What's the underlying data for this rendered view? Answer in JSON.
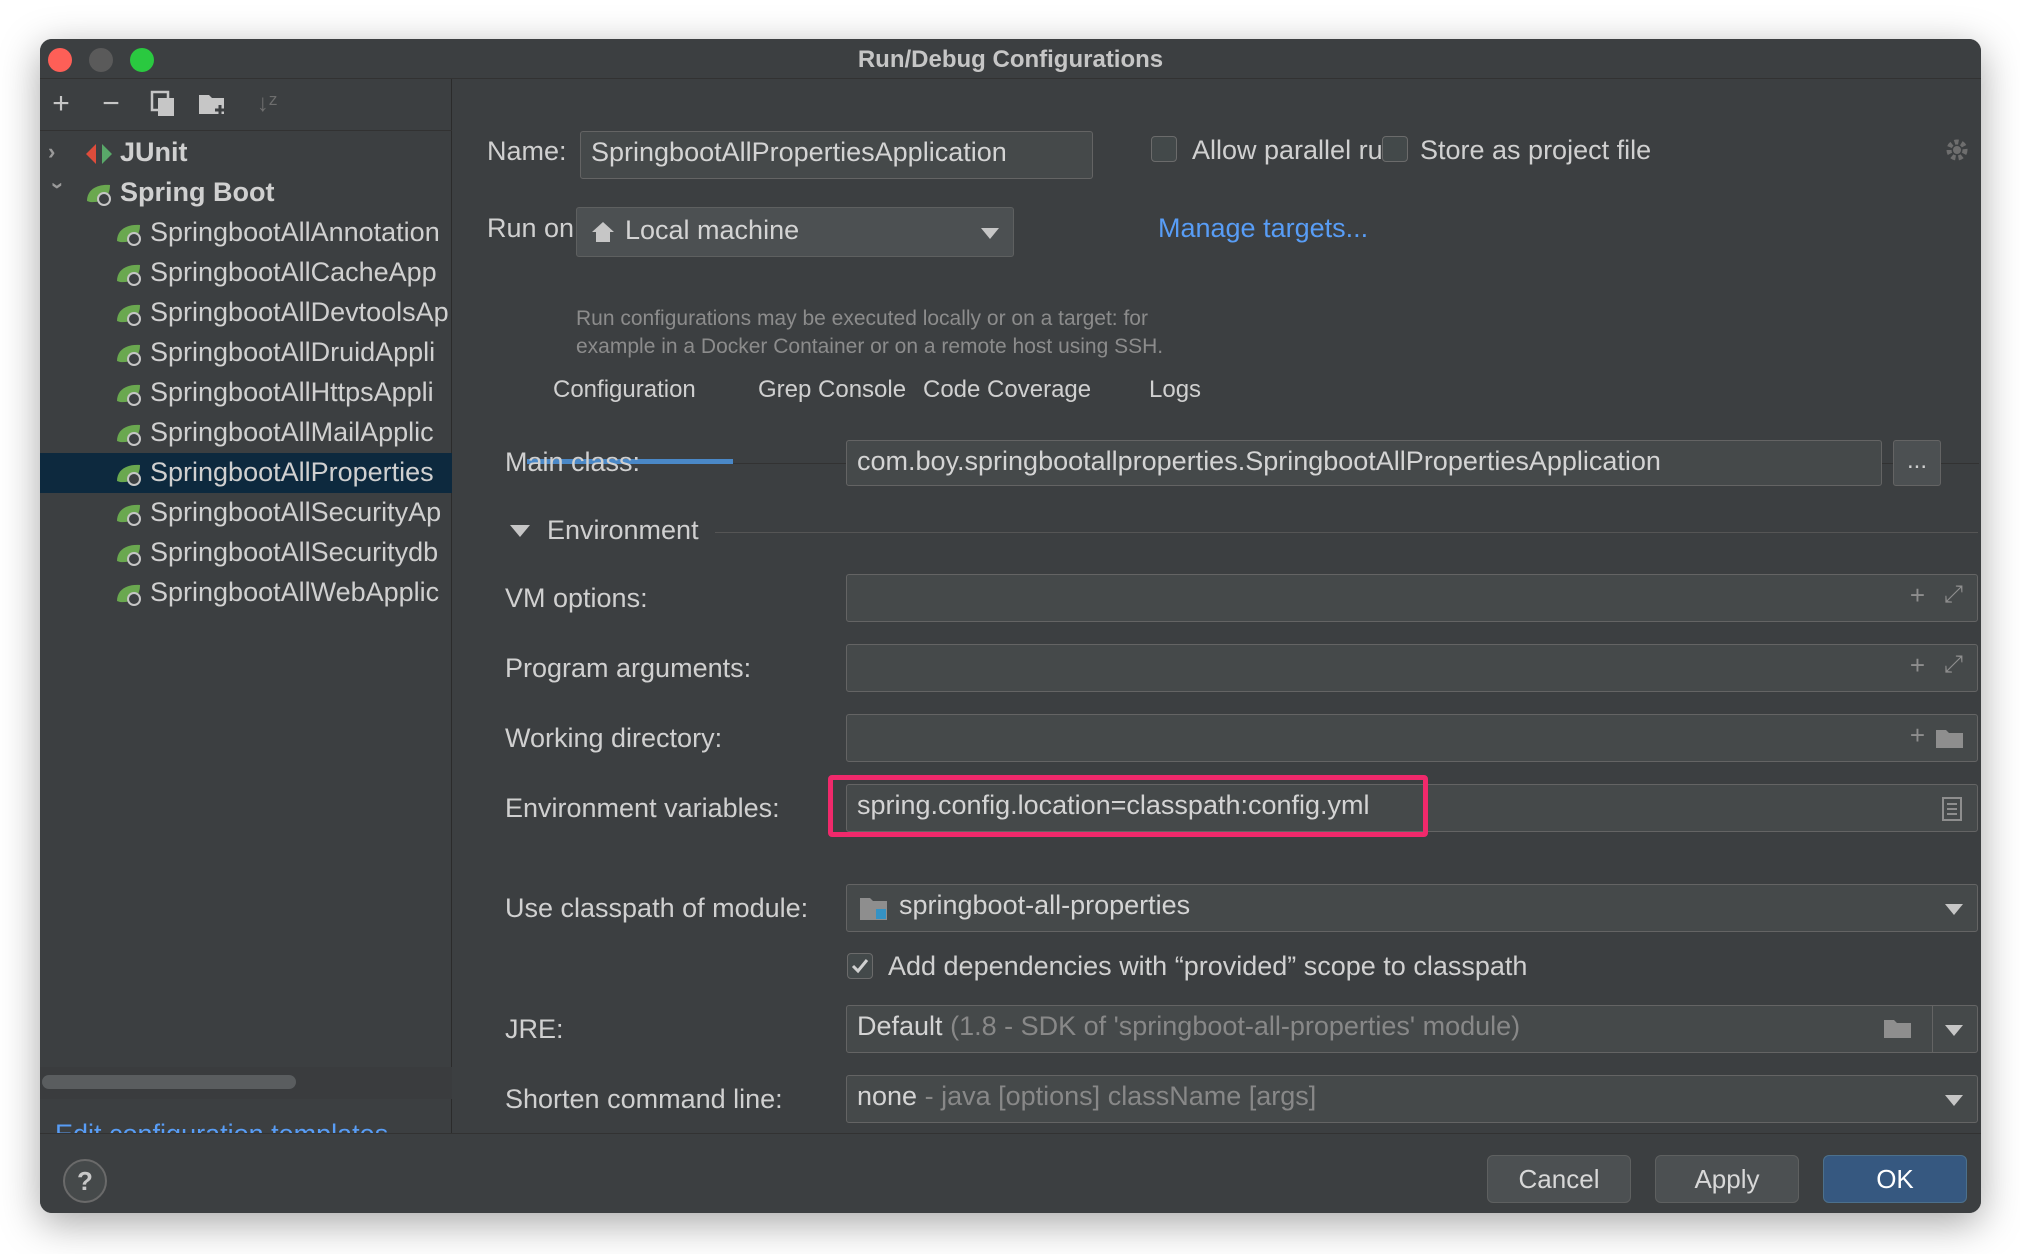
{
  "window": {
    "title": "Run/Debug Configurations"
  },
  "toolbar": {
    "add_icon": "plus-icon",
    "remove_icon": "minus-icon",
    "copy_icon": "copy-icon",
    "folder_icon": "new-folder-icon",
    "sort_icon": "sort-icon"
  },
  "tree": {
    "groups": [
      {
        "label": "JUnit",
        "expanded": false
      },
      {
        "label": "Spring Boot",
        "expanded": true
      }
    ],
    "items": [
      "SpringbootAllAnnotation",
      "SpringbootAllCacheApp",
      "SpringbootAllDevtoolsAp",
      "SpringbootAllDruidAppli",
      "SpringbootAllHttpsAppli",
      "SpringbootAllMailApplic",
      "SpringbootAllProperties",
      "SpringbootAllSecurityAp",
      "SpringbootAllSecuritydb",
      "SpringbootAllWebApplic"
    ],
    "selected_index": 6
  },
  "sidebar": {
    "edit_templates": "Edit configuration templates..."
  },
  "form": {
    "name_label": "Name:",
    "name_value": "SpringbootAllPropertiesApplication",
    "allow_parallel": "Allow parallel run",
    "store_project": "Store as project file",
    "run_on_label": "Run on:",
    "run_on_value": "Local machine",
    "manage_targets": "Manage targets...",
    "hint_line1": "Run configurations may be executed locally or on a target: for",
    "hint_line2": "example in a Docker Container or on a remote host using SSH."
  },
  "tabs": [
    {
      "label": "Configuration",
      "active": true
    },
    {
      "label": "Grep Console",
      "active": false
    },
    {
      "label": "Code Coverage",
      "active": false
    },
    {
      "label": "Logs",
      "active": false
    }
  ],
  "config": {
    "main_class_label": "Main class:",
    "main_class_value": "com.boy.springbootallproperties.SpringbootAllPropertiesApplication",
    "main_class_browse": "...",
    "environment_section": "Environment",
    "vm_options_label": "VM options:",
    "program_args_label": "Program arguments:",
    "working_dir_label": "Working directory:",
    "env_vars_label": "Environment variables:",
    "env_vars_value": "spring.config.location=classpath:config.yml",
    "classpath_label": "Use classpath of module:",
    "classpath_value": "springboot-all-properties",
    "provided_scope": "Add dependencies with “provided” scope to classpath",
    "provided_checked": true,
    "jre_label": "JRE:",
    "jre_value": "Default",
    "jre_detail": "(1.8 - SDK of 'springboot-all-properties' module)",
    "shorten_label": "Shorten command line:",
    "shorten_value": "none",
    "shorten_detail": "- java [options] className [args]"
  },
  "buttons": {
    "help": "?",
    "cancel": "Cancel",
    "apply": "Apply",
    "ok": "OK"
  },
  "colors": {
    "accent": "#589df6",
    "highlight": "#f0296b",
    "ok_button": "#365880",
    "background": "#3c3f41"
  }
}
